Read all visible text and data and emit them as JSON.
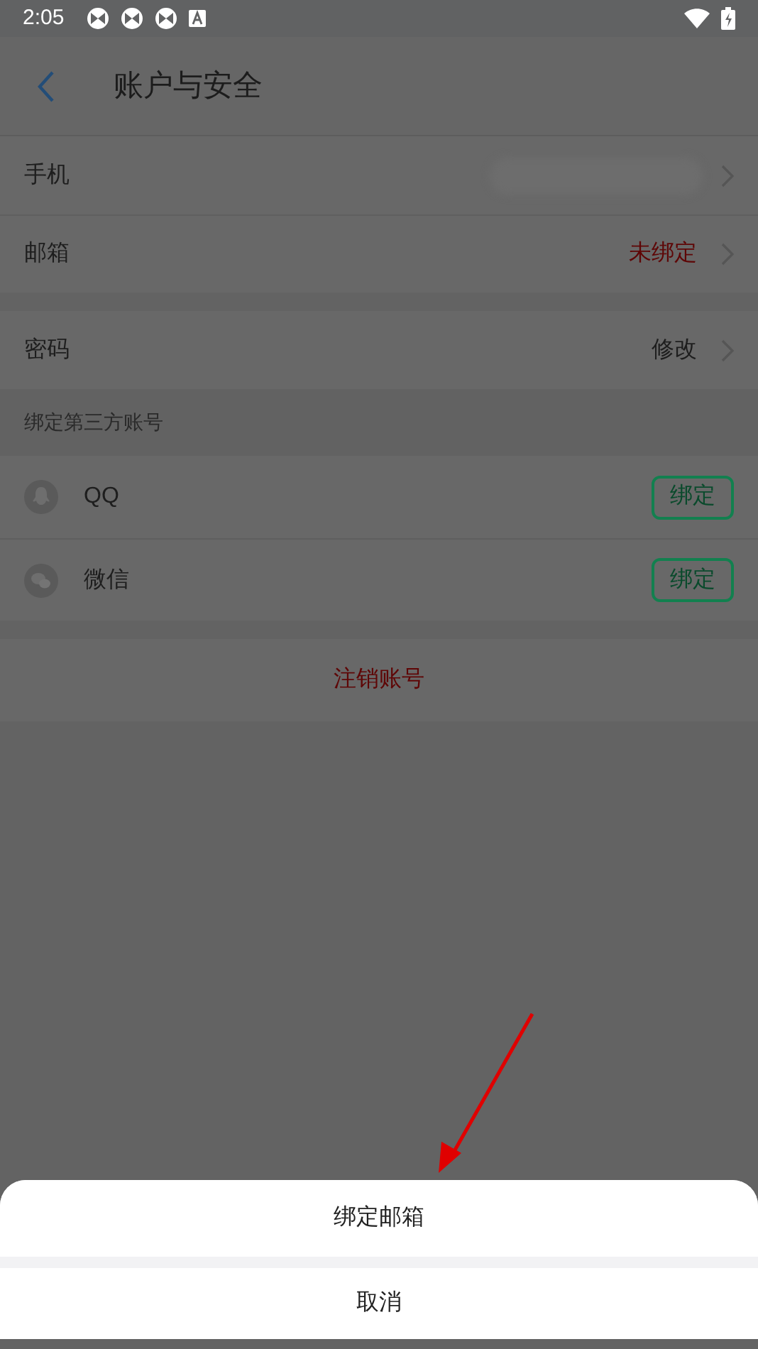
{
  "status_bar": {
    "time": "2:05"
  },
  "header": {
    "title": "账户与安全"
  },
  "groups": [
    {
      "items": [
        {
          "label": "手机",
          "kind": "blurred"
        },
        {
          "label": "邮箱",
          "value": "未绑定",
          "kind": "warning"
        }
      ]
    },
    {
      "items": [
        {
          "label": "密码",
          "value": "修改",
          "kind": "normal"
        }
      ]
    }
  ],
  "third_party": {
    "heading": "绑定第三方账号",
    "accounts": [
      {
        "name": "QQ",
        "kind": "qq",
        "action": "绑定"
      },
      {
        "name": "微信",
        "kind": "wechat",
        "action": "绑定"
      }
    ]
  },
  "logout": "注销账号",
  "sheet": {
    "option": "绑定邮箱",
    "cancel": "取消"
  }
}
